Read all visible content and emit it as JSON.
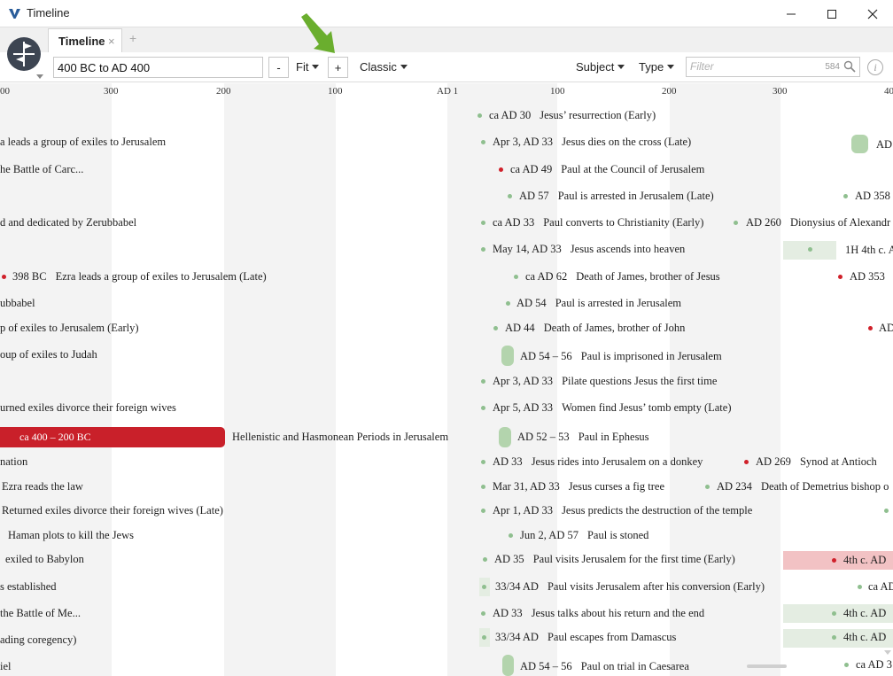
{
  "window": {
    "title": "Timeline"
  },
  "tabs": [
    {
      "label": "Timeline",
      "close": "×"
    }
  ],
  "tab_add": "+",
  "toolbar": {
    "range_value": "400 BC to AD 400",
    "zoom_out_label": "-",
    "fit_label": "Fit",
    "zoom_in_label": "+",
    "style_label": "Classic",
    "subject_label": "Subject",
    "type_label": "Type",
    "filter_placeholder": "Filter",
    "filter_count": "584"
  },
  "colors": {
    "accent_red": "#c9202a",
    "event_green": "#b3d4ad",
    "band_gray": "#f3f3f3",
    "arrow_green": "#6aae2e"
  },
  "axis": [
    "300",
    "200",
    "100",
    "AD 1",
    "100",
    "200",
    "300",
    "40"
  ],
  "axis_edge": "00",
  "bar": {
    "date": "ca 400 – 200 BC",
    "title": "Hellenistic and Hasmonean Periods in Jerusalem"
  },
  "events": [
    {
      "date": "ca AD 30",
      "title": "Jesus’ resurrection (Early)"
    },
    {
      "date": "Apr 3, AD 33",
      "title": "Jesus dies on the cross (Late)"
    },
    {
      "date": "ca AD 49",
      "title": "Paul at the Council of Jerusalem"
    },
    {
      "date": "AD 57",
      "title": "Paul is arrested in Jerusalem (Late)"
    },
    {
      "date": "ca AD 33",
      "title": "Paul converts to Christianity (Early)"
    },
    {
      "date": "May 14, AD 33",
      "title": "Jesus ascends into heaven"
    },
    {
      "date": "ca AD 62",
      "title": "Death of James, brother of Jesus"
    },
    {
      "date": "AD 54",
      "title": "Paul is arrested in Jerusalem"
    },
    {
      "date": "AD 44",
      "title": "Death of James, brother of John"
    },
    {
      "date": "AD 54 – 56",
      "title": "Paul is imprisoned in Jerusalem"
    },
    {
      "date": "Apr 3, AD 33",
      "title": "Pilate questions Jesus the first time"
    },
    {
      "date": "Apr 5, AD 33",
      "title": "Women find Jesus’ tomb empty (Late)"
    },
    {
      "date": "AD 52 – 53",
      "title": "Paul in Ephesus"
    },
    {
      "date": "AD 33",
      "title": "Jesus rides into Jerusalem on a donkey"
    },
    {
      "date": "Mar 31, AD 33",
      "title": "Jesus curses a fig tree"
    },
    {
      "date": "Apr 1, AD 33",
      "title": "Jesus predicts the destruction of the temple"
    },
    {
      "date": "Jun 2, AD 57",
      "title": "Paul is stoned"
    },
    {
      "date": "AD 35",
      "title": "Paul visits Jerusalem for the first time (Early)"
    },
    {
      "date": "33/34 AD",
      "title": "Paul visits Jerusalem after his conversion (Early)"
    },
    {
      "date": "AD 33",
      "title": "Jesus talks about his return and the end"
    },
    {
      "date": "33/34 AD",
      "title": "Paul escapes from Damascus"
    },
    {
      "date": "AD 54 – 56",
      "title": "Paul on trial in Caesarea"
    },
    {
      "date": "AD 260",
      "title": "Dionysius of Alexandr"
    },
    {
      "date": "AD 269",
      "title": "Synod at Antioch"
    },
    {
      "date": "AD 234",
      "title": "Death of Demetrius bishop o"
    },
    {
      "date": "398 BC",
      "title": "Ezra leads a group of exiles to Jerusalem (Late)"
    }
  ],
  "cut_left": [
    "a leads a group of exiles to Jerusalem",
    "he Battle of Carc...",
    "d and dedicated by Zerubbabel",
    "ubbabel",
    "p of exiles to Jerusalem (Early)",
    "oup of exiles to Judah",
    "urned exiles divorce their foreign wives",
    "nation",
    "Ezra reads the law",
    "Returned exiles divorce their foreign wives (Late)",
    "Haman plots to kill the Jews",
    "exiled to Babylon",
    "s established",
    "the Battle of Me...",
    "ading coregency)",
    "iel"
  ],
  "cut_right": [
    "AD",
    "AD 358",
    "1H 4th c. A",
    "AD 353",
    "AD",
    "4th c. AD",
    "ca AD",
    "4th c. AD",
    "4th c. AD",
    "ca AD 3"
  ]
}
